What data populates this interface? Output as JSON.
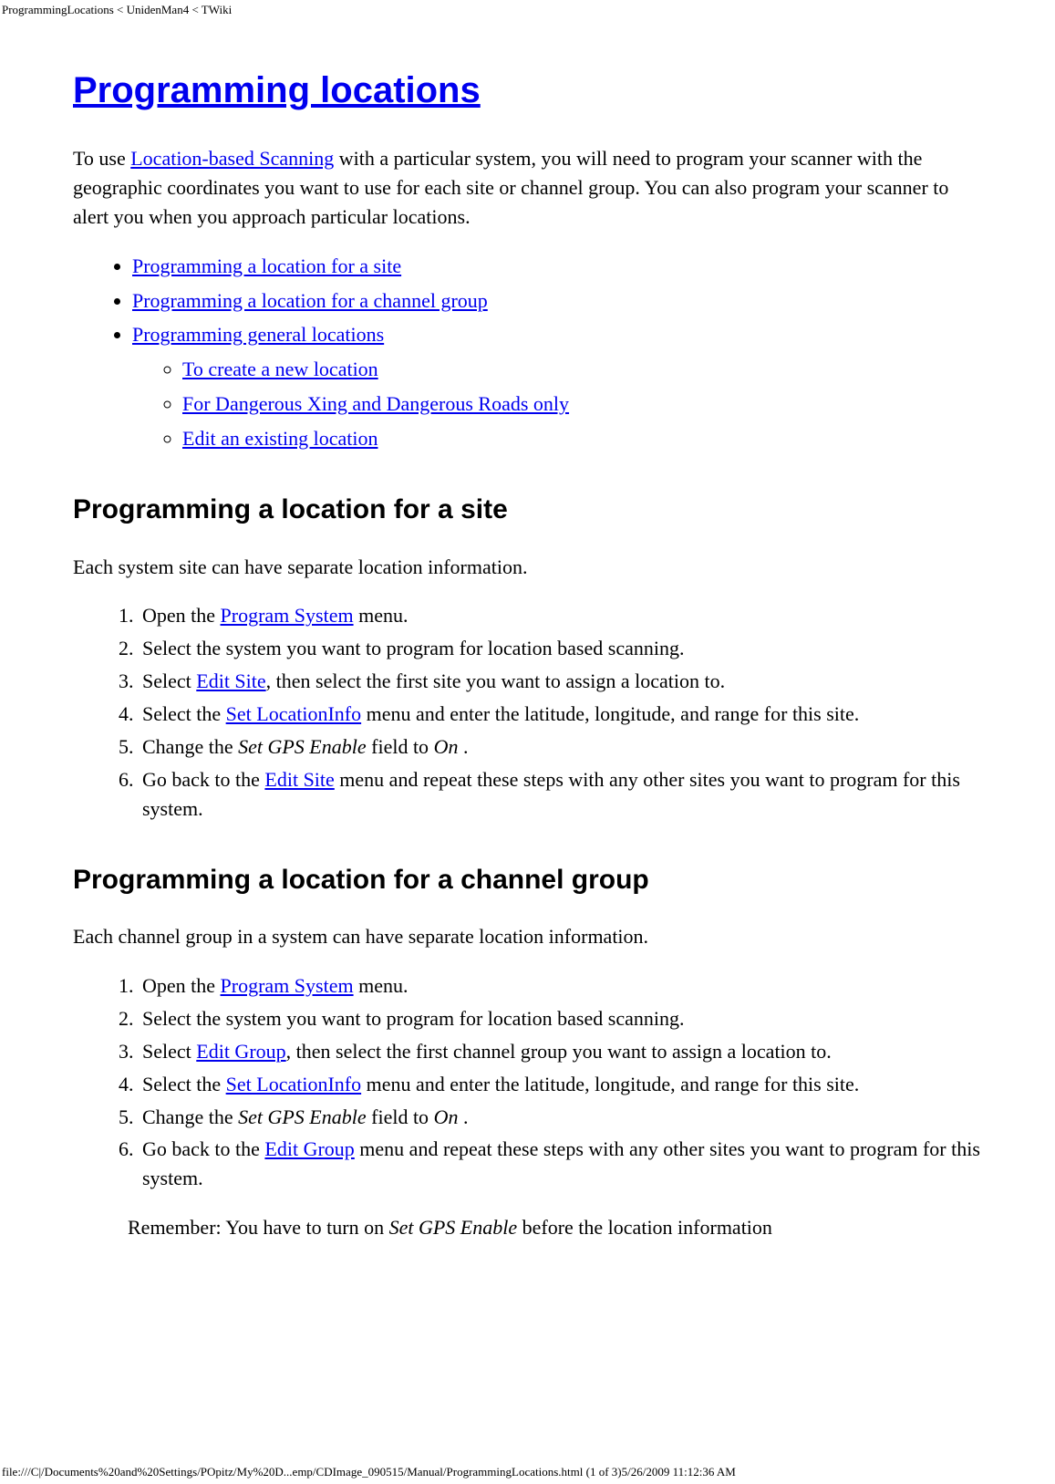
{
  "header": "ProgrammingLocations < UnidenMan4 < TWiki",
  "footer": "file:///C|/Documents%20and%20Settings/POpitz/My%20D...emp/CDImage_090515/Manual/ProgrammingLocations.html (1 of 3)5/26/2009 11:12:36 AM",
  "title": "Programming locations",
  "intro_1": "To use ",
  "intro_link": "Location-based Scanning",
  "intro_2": " with a particular system, you will need to program your scanner with the geographic coordinates you want to use for each site or channel group. You can also program your scanner to alert you when you approach particular locations.",
  "toc": {
    "i1": "Programming a location for a site",
    "i2": "Programming a location for a channel group",
    "i3": "Programming general locations",
    "i3a": "To create a new location",
    "i3b": "For Dangerous Xing and Dangerous Roads only",
    "i3c": "Edit an existing location"
  },
  "sec1": {
    "heading": "Programming a location for a site",
    "intro": "Each system site can have separate location information.",
    "s1a": "Open the ",
    "s1b": "Program System",
    "s1c": " menu.",
    "s2": "Select the system you want to program for location based scanning.",
    "s3a": "Select ",
    "s3b": "Edit Site",
    "s3c": ", then select the first site you want to assign a location to.",
    "s4a": "Select the ",
    "s4b": "Set LocationInfo",
    "s4c": " menu and enter the latitude, longitude, and range for this site.",
    "s5a": "Change the ",
    "s5b": "Set GPS Enable",
    "s5c": " field to ",
    "s5d": "On",
    "s5e": " .",
    "s6a": "Go back to the ",
    "s6b": "Edit Site",
    "s6c": " menu and repeat these steps with any other sites you want to program for this system."
  },
  "sec2": {
    "heading": "Programming a location for a channel group",
    "intro": "Each channel group in a system can have separate location information.",
    "s1a": "Open the ",
    "s1b": "Program System",
    "s1c": " menu.",
    "s2": "Select the system you want to program for location based scanning.",
    "s3a": "Select ",
    "s3b": "Edit Group",
    "s3c": ", then select the first channel group you want to assign a location to.",
    "s4a": "Select the ",
    "s4b": "Set LocationInfo",
    "s4c": " menu and enter the latitude, longitude, and range for this site.",
    "s5a": "Change the ",
    "s5b": "Set GPS Enable",
    "s5c": " field to ",
    "s5d": "On",
    "s5e": " .",
    "s6a": "Go back to the ",
    "s6b": "Edit Group",
    "s6c": " menu and repeat these steps with any other sites you want to program for this system.",
    "note_a": "Remember: You have to turn on ",
    "note_b": "Set GPS Enable",
    "note_c": " before the location information"
  }
}
